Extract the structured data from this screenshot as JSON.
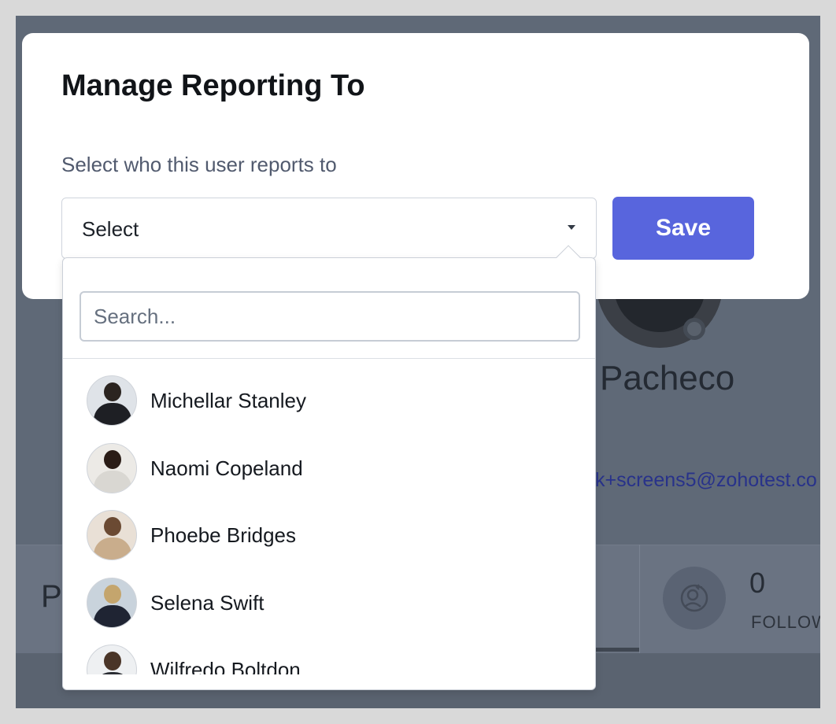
{
  "modal": {
    "title": "Manage Reporting To",
    "subtitle": "Select who this user reports to",
    "select_value": "Select",
    "save_label": "Save"
  },
  "dropdown": {
    "search_placeholder": "Search...",
    "options": [
      {
        "name": "Michellar Stanley",
        "avatar_bg": "#dfe3e8",
        "hair": "#2b2420",
        "suit": "#1e1f24"
      },
      {
        "name": "Naomi Copeland",
        "avatar_bg": "#eceae6",
        "hair": "#2a1c16",
        "suit": "#d9d7d2"
      },
      {
        "name": "Phoebe Bridges",
        "avatar_bg": "#e9e0d6",
        "hair": "#6b4a33",
        "suit": "#c9ad8c"
      },
      {
        "name": "Selena Swift",
        "avatar_bg": "#c9d3dc",
        "hair": "#c4a56d",
        "suit": "#1f2433"
      },
      {
        "name": "Wilfredo Boltdon",
        "avatar_bg": "#eef0f2",
        "hair": "#4a3528",
        "suit": "#2a2d33"
      }
    ]
  },
  "background": {
    "name_fragment": "Pacheco",
    "email_fragment": "k+screens5@zohotest.co",
    "tab_letter": "P",
    "followers_count": "0",
    "followers_label": "FOLLOW"
  },
  "colors": {
    "accent": "#5865dd",
    "overlay": "#606a78"
  }
}
